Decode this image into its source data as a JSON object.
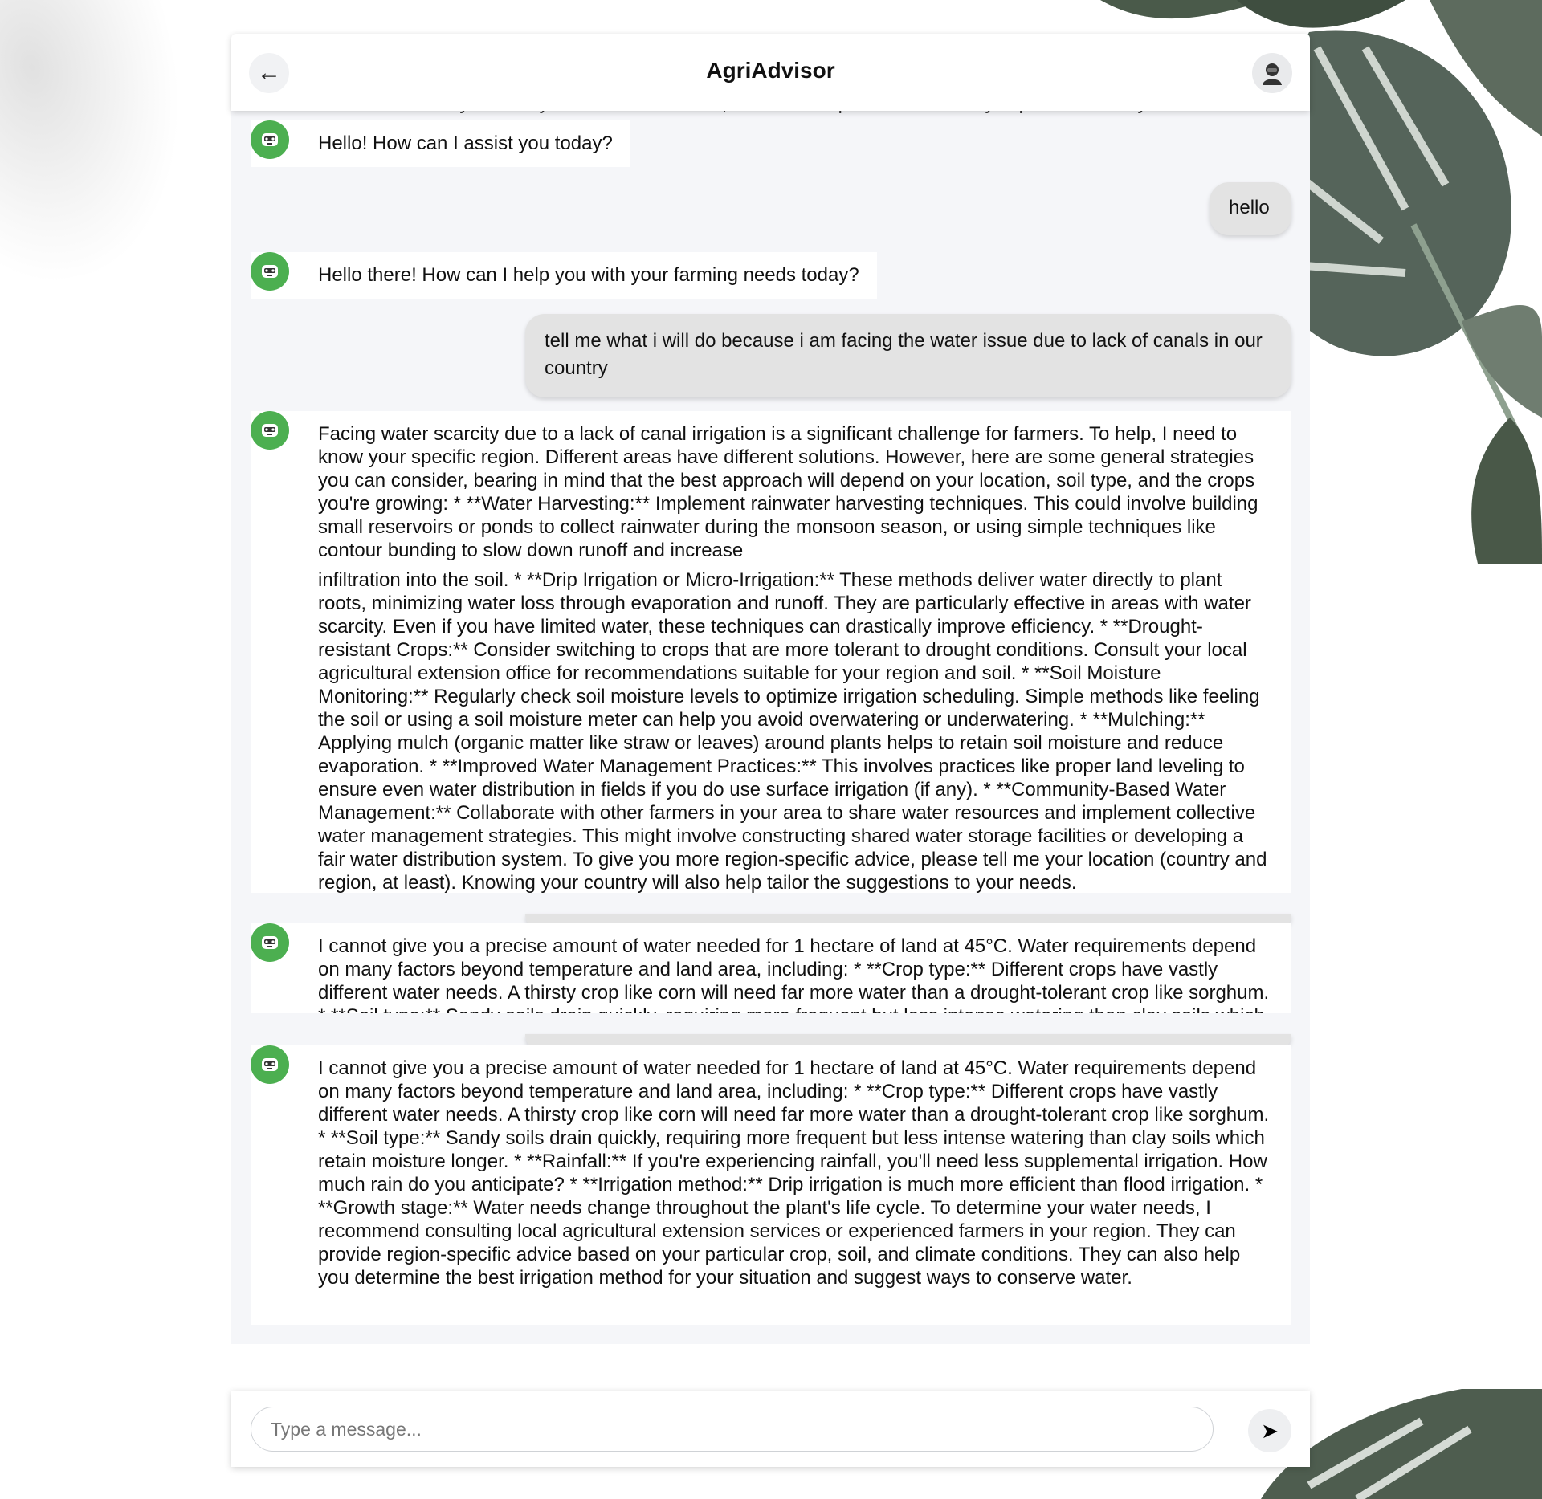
{
  "header": {
    "title": "AgriAdvisor",
    "back_icon": "←",
    "clipped_line": "with water scarcity. Even if you have limited water, these techniques can drastically improve efficiency."
  },
  "messages": [
    {
      "role": "bot",
      "text": "Hello! How can I assist you today?"
    },
    {
      "role": "user",
      "text": "hello"
    },
    {
      "role": "bot",
      "text": "Hello there! How can I help you with your farming needs today?"
    },
    {
      "role": "user",
      "text": "tell me what i will do because i am facing the water issue due to lack of canals in our country"
    },
    {
      "role": "bot",
      "text_part1": "Facing water scarcity due to a lack of canal irrigation is a significant challenge for farmers. To help, I need to know your specific region. Different areas have different solutions. However, here are some general strategies you can consider, bearing in mind that the best approach will depend on your location, soil type, and the crops you're growing: * **Water Harvesting:** Implement rainwater harvesting techniques. This could involve building small reservoirs or ponds to collect rainwater during the monsoon season, or using simple techniques like contour bunding to slow down runoff and increase",
      "text_part2": "infiltration into the soil. * **Drip Irrigation or Micro-Irrigation:** These methods deliver water directly to plant roots, minimizing water loss through evaporation and runoff. They are particularly effective in areas with water scarcity. Even if you have limited water, these techniques can drastically improve efficiency. * **Drought-resistant Crops:** Consider switching to crops that are more tolerant to drought conditions. Consult your local agricultural extension office for recommendations suitable for your region and soil. * **Soil Moisture Monitoring:** Regularly check soil moisture levels to optimize irrigation scheduling. Simple methods like feeling the soil or using a soil moisture meter can help you avoid overwatering or underwatering. * **Mulching:** Applying mulch (organic matter like straw or leaves) around plants helps to retain soil moisture and reduce evaporation. * **Improved Water Management Practices:** This involves practices like proper land leveling to ensure even water distribution in fields if you do use surface irrigation (if any). * **Community-Based Water Management:** Collaborate with other farmers in your area to share water resources and implement collective water management strategies. This might involve constructing shared water storage facilities or developing a fair water distribution system. To give you more region-specific advice, please tell me your location (country and region, at least). Knowing your country will also help tailor the suggestions to your needs."
    },
    {
      "role": "bot",
      "text": "I cannot give you a precise amount of water needed for 1 hectare of land at 45°C. Water requirements depend on many factors beyond temperature and land area, including: * **Crop type:** Different crops have vastly different water needs. A thirsty crop like corn will need far more water than a drought-tolerant crop like sorghum. * **Soil type:** Sandy soils drain quickly, requiring more frequent but less intense watering than clay soils which retain moisture longer."
    },
    {
      "role": "bot",
      "text": "I cannot give you a precise amount of water needed for 1 hectare of land at 45°C. Water requirements depend on many factors beyond temperature and land area, including: * **Crop type:** Different crops have vastly different water needs. A thirsty crop like corn will need far more water than a drought-tolerant crop like sorghum. * **Soil type:** Sandy soils drain quickly, requiring more frequent but less intense watering than clay soils which retain moisture longer. * **Rainfall:** If you're experiencing rainfall, you'll need less supplemental irrigation. How much rain do you anticipate? * **Irrigation method:** Drip irrigation is much more efficient than flood irrigation. * **Growth stage:** Water needs change throughout the plant's life cycle. To determine your water needs, I recommend consulting local agricultural extension services or experienced farmers in your region. They can provide region-specific advice based on your particular crop, soil, and climate conditions. They can also help you determine the best irrigation method for your situation and suggest ways to conserve water."
    }
  ],
  "composer": {
    "placeholder": "Type a message...",
    "send_icon": "➤"
  },
  "icons": {
    "bot_avatar": "robot-icon",
    "profile": "user-avatar-icon"
  },
  "colors": {
    "bot_avatar_bg": "#4caf50",
    "user_bubble_bg": "#e3e3e3",
    "chat_bg": "#f5f6f9"
  }
}
